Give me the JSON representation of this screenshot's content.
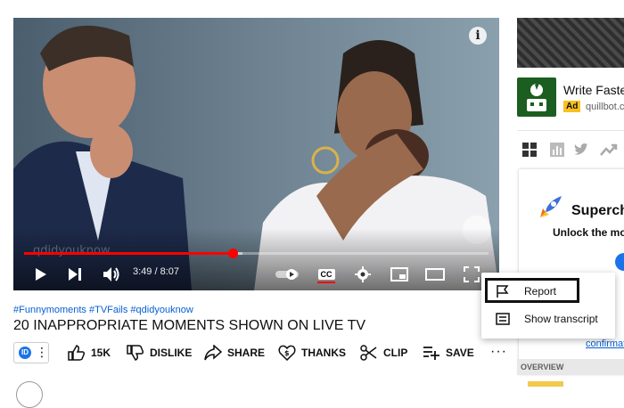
{
  "player": {
    "info_icon": "i",
    "watermark": "qdidyouknow",
    "current_time": "3:49",
    "separator": "/",
    "duration": "8:07",
    "progress_fraction": 0.45,
    "buffered_fraction": 0.47,
    "cc_label": "CC",
    "controls": [
      "play-icon",
      "next-icon",
      "volume-icon",
      "autoplay-toggle",
      "cc-icon",
      "settings-icon",
      "miniplayer-icon",
      "theater-icon",
      "fullscreen-icon"
    ]
  },
  "video": {
    "hashtags": "#Funnymoments #TVFails #qdidyouknow",
    "title": "20 INAPPROPRIATE MOMENTS SHOWN ON LIVE TV",
    "channel_avatar_text": "ID"
  },
  "actions": [
    {
      "icon": "like-icon",
      "label": "15K"
    },
    {
      "icon": "dislike-icon",
      "label": "DISLIKE"
    },
    {
      "icon": "share-icon",
      "label": "SHARE"
    },
    {
      "icon": "thanks-icon",
      "label": "THANKS"
    },
    {
      "icon": "clip-icon",
      "label": "CLIP"
    },
    {
      "icon": "save-icon",
      "label": "SAVE"
    }
  ],
  "menu": {
    "items": [
      {
        "icon": "flag-icon",
        "label": "Report"
      },
      {
        "icon": "transcript-icon",
        "label": "Show transcript"
      }
    ]
  },
  "sidebar": {
    "ad_title": "Write Faste",
    "ad_badge": "Ad",
    "ad_url": "quillbot.co",
    "card_title": "Superch",
    "card_subtitle": "Unlock the mos",
    "confirm_link": "confirmat",
    "overview_label": "OVERVIEW"
  },
  "colors": {
    "accent_red": "#ff0000",
    "link_blue": "#065fd4",
    "ad_badge": "#f9c020"
  }
}
